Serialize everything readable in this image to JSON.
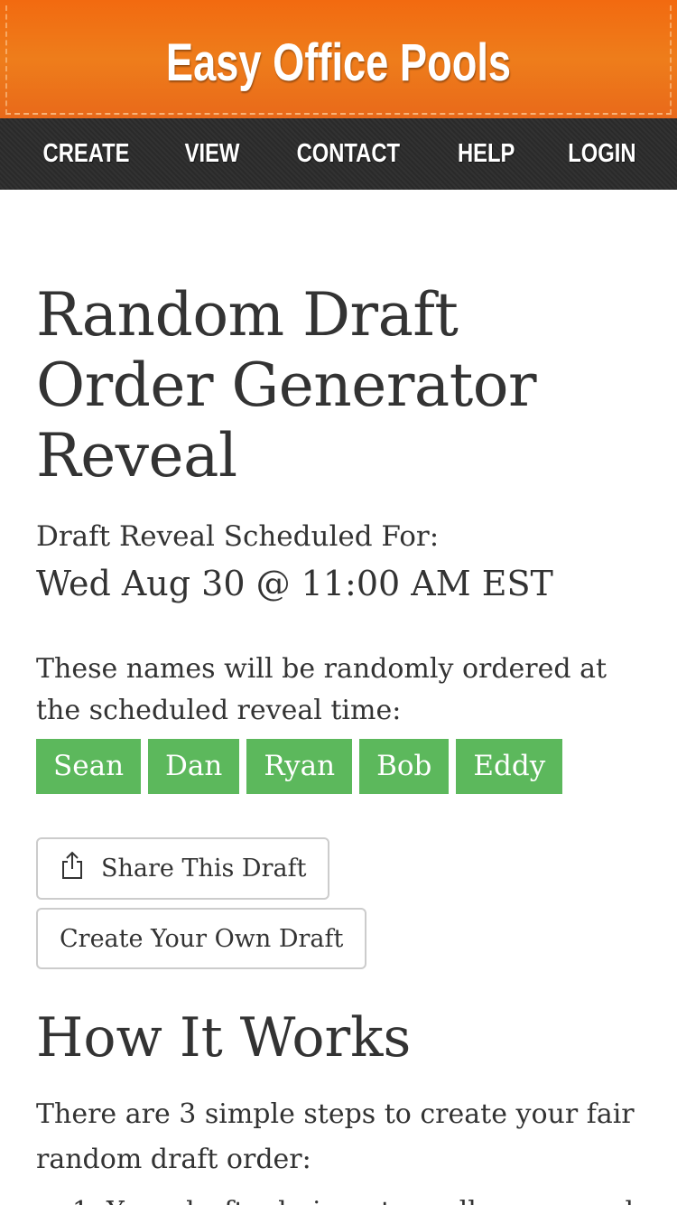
{
  "header": {
    "site_title": "Easy Office Pools",
    "brand_color": "#ef7318"
  },
  "nav": {
    "items": [
      {
        "label": "CREATE"
      },
      {
        "label": "VIEW"
      },
      {
        "label": "CONTACT"
      },
      {
        "label": "HELP"
      },
      {
        "label": "LOGIN"
      }
    ]
  },
  "main": {
    "title": "Random Draft Order Generator Reveal",
    "schedule_label": "Draft Reveal Scheduled For:",
    "schedule_value": "Wed Aug 30 @ 11:00 AM EST",
    "names_intro": "These names will be randomly ordered at the scheduled reveal time:",
    "names": [
      "Sean",
      "Dan",
      "Ryan",
      "Bob",
      "Eddy"
    ],
    "name_chip_color": "#5cb85c",
    "share_button": {
      "label": "Share This Draft",
      "icon": "share-icon"
    },
    "create_button": {
      "label": "Create Your Own Draft"
    }
  },
  "how_it_works": {
    "title": "How It Works",
    "intro": "There are 3 simple steps to create your fair random draft order:",
    "steps": [
      "Your draft admin enters all names and"
    ]
  }
}
